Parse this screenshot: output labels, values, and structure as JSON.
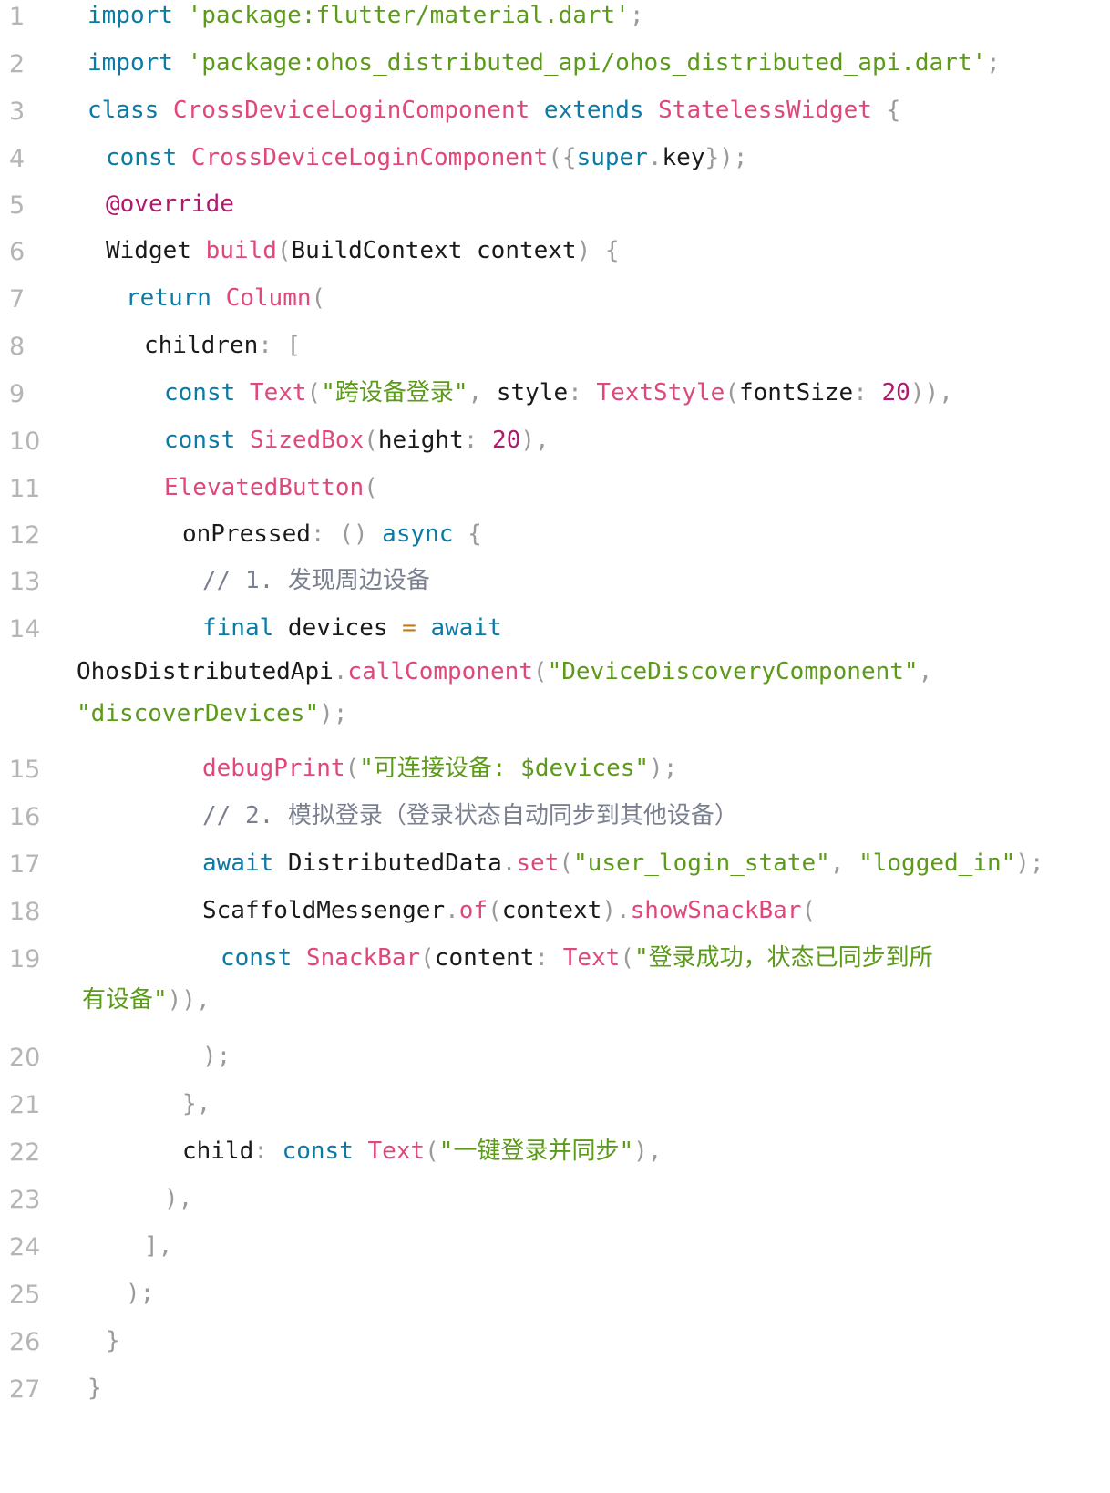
{
  "editor": {
    "lines": [
      {
        "number": "1",
        "tokens": [
          [
            "kw",
            "import "
          ],
          [
            "str",
            "'package:flutter/material.dart'"
          ],
          [
            "punc",
            ";"
          ]
        ]
      },
      {
        "number": "2",
        "tokens": [
          [
            "kw",
            "import "
          ],
          [
            "str",
            "'package:ohos_distributed_api/ohos_distributed_api.dart'"
          ],
          [
            "punc",
            ";"
          ]
        ]
      },
      {
        "number": "3",
        "tokens": [
          [
            "kw",
            "class "
          ],
          [
            "type",
            "CrossDeviceLoginComponent "
          ],
          [
            "kw",
            "extends "
          ],
          [
            "type",
            "StatelessWidget "
          ],
          [
            "punc",
            "{"
          ]
        ]
      },
      {
        "number": "4",
        "tokens": [
          [
            "kw",
            "const "
          ],
          [
            "type",
            "CrossDeviceLoginComponent"
          ],
          [
            "punc",
            "({"
          ],
          [
            "kw",
            "super"
          ],
          [
            "punc",
            "."
          ],
          [
            "id",
            "key"
          ],
          [
            "punc",
            "});"
          ]
        ]
      },
      {
        "number": "5",
        "tokens": [
          [
            "ann",
            "@override"
          ]
        ]
      },
      {
        "number": "6",
        "tokens": [
          [
            "id",
            "Widget "
          ],
          [
            "fn",
            "build"
          ],
          [
            "punc",
            "("
          ],
          [
            "id",
            "BuildContext context"
          ],
          [
            "punc",
            ") {"
          ]
        ]
      },
      {
        "number": "7",
        "tokens": [
          [
            "kw",
            "return "
          ],
          [
            "type",
            "Column"
          ],
          [
            "punc",
            "("
          ]
        ]
      },
      {
        "number": "8",
        "tokens": [
          [
            "id",
            "children"
          ],
          [
            "punc",
            ": ["
          ]
        ]
      },
      {
        "number": "9",
        "tokens": [
          [
            "kw",
            "const "
          ],
          [
            "type",
            "Text"
          ],
          [
            "punc",
            "("
          ],
          [
            "str",
            "\"跨设备登录\""
          ],
          [
            "punc",
            ", "
          ],
          [
            "id",
            "style"
          ],
          [
            "punc",
            ": "
          ],
          [
            "type",
            "TextStyle"
          ],
          [
            "punc",
            "("
          ],
          [
            "id",
            "fontSize"
          ],
          [
            "punc",
            ": "
          ],
          [
            "num",
            "20"
          ],
          [
            "punc",
            ")),"
          ]
        ]
      },
      {
        "number": "10",
        "tokens": [
          [
            "kw",
            "const "
          ],
          [
            "type",
            "SizedBox"
          ],
          [
            "punc",
            "("
          ],
          [
            "id",
            "height"
          ],
          [
            "punc",
            ": "
          ],
          [
            "num",
            "20"
          ],
          [
            "punc",
            "),"
          ]
        ]
      },
      {
        "number": "11",
        "tokens": [
          [
            "type",
            "ElevatedButton"
          ],
          [
            "punc",
            "("
          ]
        ]
      },
      {
        "number": "12",
        "tokens": [
          [
            "id",
            "onPressed"
          ],
          [
            "punc",
            ": () "
          ],
          [
            "kw",
            "async "
          ],
          [
            "punc",
            "{"
          ]
        ]
      },
      {
        "number": "13",
        "tokens": [
          [
            "cm",
            "// 1. 发现周边设备"
          ]
        ]
      },
      {
        "number": "14",
        "tokens": [
          [
            "kw",
            "final "
          ],
          [
            "id",
            "devices "
          ],
          [
            "op",
            "= "
          ],
          [
            "kw",
            "await"
          ]
        ]
      },
      {
        "number": "",
        "tokens": [
          [
            "id",
            "OhosDistributedApi"
          ],
          [
            "punc",
            "."
          ],
          [
            "fn",
            "callComponent"
          ],
          [
            "punc",
            "("
          ],
          [
            "str",
            "\"DeviceDiscoveryComponent\""
          ],
          [
            "punc",
            ","
          ]
        ]
      },
      {
        "number": "",
        "tokens": [
          [
            "str",
            "\"discoverDevices\""
          ],
          [
            "punc",
            ");"
          ]
        ]
      },
      {
        "number": "15",
        "tokens": [
          [
            "fn",
            "debugPrint"
          ],
          [
            "punc",
            "("
          ],
          [
            "str",
            "\"可连接设备: $devices\""
          ],
          [
            "punc",
            ");"
          ]
        ]
      },
      {
        "number": "16",
        "tokens": [
          [
            "cm",
            "// 2. 模拟登录（登录状态自动同步到其他设备）"
          ]
        ]
      },
      {
        "number": "17",
        "tokens": [
          [
            "kw",
            "await "
          ],
          [
            "id",
            "DistributedData"
          ],
          [
            "punc",
            "."
          ],
          [
            "fn",
            "set"
          ],
          [
            "punc",
            "("
          ],
          [
            "str",
            "\"user_login_state\""
          ],
          [
            "punc",
            ", "
          ],
          [
            "str",
            "\"logged_in\""
          ],
          [
            "punc",
            ");"
          ]
        ]
      },
      {
        "number": "18",
        "tokens": [
          [
            "id",
            "ScaffoldMessenger"
          ],
          [
            "punc",
            "."
          ],
          [
            "fn",
            "of"
          ],
          [
            "punc",
            "("
          ],
          [
            "id",
            "context"
          ],
          [
            "punc",
            ")."
          ],
          [
            "fn",
            "showSnackBar"
          ],
          [
            "punc",
            "("
          ]
        ]
      },
      {
        "number": "19",
        "tokens": [
          [
            "kw",
            "const "
          ],
          [
            "type",
            "SnackBar"
          ],
          [
            "punc",
            "("
          ],
          [
            "id",
            "content"
          ],
          [
            "punc",
            ": "
          ],
          [
            "type",
            "Text"
          ],
          [
            "punc",
            "("
          ],
          [
            "str",
            "\"登录成功，状态已同步到所"
          ]
        ]
      },
      {
        "number": "",
        "tokens": [
          [
            "str",
            "有设备\""
          ],
          [
            "punc",
            ")),"
          ]
        ]
      },
      {
        "number": "20",
        "tokens": [
          [
            "punc",
            ");"
          ]
        ]
      },
      {
        "number": "21",
        "tokens": [
          [
            "punc",
            "},"
          ]
        ]
      },
      {
        "number": "22",
        "tokens": [
          [
            "id",
            "child"
          ],
          [
            "punc",
            ": "
          ],
          [
            "kw",
            "const "
          ],
          [
            "type",
            "Text"
          ],
          [
            "punc",
            "("
          ],
          [
            "str",
            "\"一键登录并同步\""
          ],
          [
            "punc",
            "),"
          ]
        ]
      },
      {
        "number": "23",
        "tokens": [
          [
            "punc",
            "),"
          ]
        ]
      },
      {
        "number": "24",
        "tokens": [
          [
            "punc",
            "],"
          ]
        ]
      },
      {
        "number": "25",
        "tokens": [
          [
            "punc",
            ");"
          ]
        ]
      },
      {
        "number": "26",
        "tokens": [
          [
            "punc",
            "}"
          ]
        ]
      },
      {
        "number": "27",
        "tokens": [
          [
            "punc",
            "}"
          ]
        ]
      }
    ]
  }
}
